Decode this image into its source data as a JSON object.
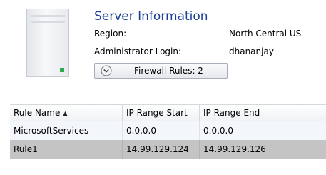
{
  "server": {
    "title": "Server Information",
    "region_label": "Region:",
    "region_value": "North Central US",
    "admin_label": "Administrator Login:",
    "admin_value": "dhananjay",
    "firewall_button_label": "Firewall Rules: 2"
  },
  "grid": {
    "columns": [
      "Rule Name",
      "IP Range Start",
      "IP Range End"
    ],
    "sort": {
      "column": "Rule Name",
      "direction": "ascending"
    },
    "rows": [
      {
        "name": "MicrosoftServices",
        "start": "0.0.0.0",
        "end": "0.0.0.0"
      },
      {
        "name": "Rule1",
        "start": "14.99.129.124",
        "end": "14.99.129.126"
      }
    ]
  },
  "colors": {
    "title": "#1c3f95",
    "selected_row": "#c4c4c4",
    "alt_row": "#f3f6fa",
    "status_led": "#2ea84a"
  },
  "icons": {
    "server": "server-icon",
    "expand": "chevron-down-circle-icon",
    "sort": "sort-ascending-icon"
  }
}
